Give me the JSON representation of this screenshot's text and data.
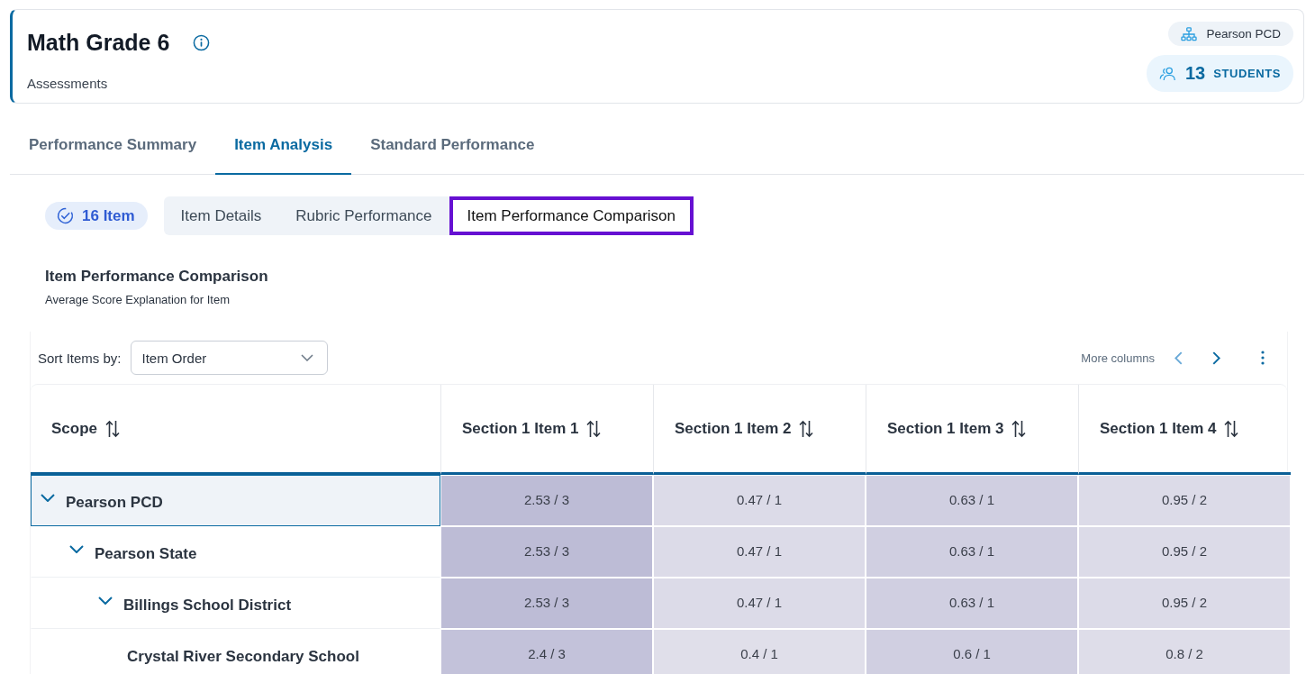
{
  "header": {
    "title": "Math Grade 6",
    "subtitle": "Assessments",
    "org": "Pearson PCD",
    "student_count": "13",
    "student_label": "STUDENTS"
  },
  "tabs": [
    {
      "label": "Performance Summary",
      "selected": false
    },
    {
      "label": "Item Analysis",
      "selected": true
    },
    {
      "label": "Standard Performance",
      "selected": false
    }
  ],
  "item_count": "16 Item",
  "subtabs": [
    {
      "label": "Item Details",
      "selected": false
    },
    {
      "label": "Rubric Performance",
      "selected": false
    },
    {
      "label": "Item Performance Comparison",
      "selected": true
    }
  ],
  "section": {
    "title": "Item Performance Comparison",
    "subtitle": "Average Score Explanation for Item"
  },
  "sort": {
    "label": "Sort Items by:",
    "value": "Item Order"
  },
  "pager": {
    "label": "More columns",
    "previous_disabled": true,
    "next_disabled": false
  },
  "table": {
    "scope_column": "Scope",
    "columns": [
      "Section 1 Item 1",
      "Section 1 Item 2",
      "Section 1 Item 3",
      "Section 1 Item 4"
    ],
    "rows": [
      {
        "scope": "Pearson PCD",
        "expanded": true,
        "selected": true,
        "cells": [
          {
            "text": "2.53 / 3",
            "color": "#bdbcd6"
          },
          {
            "text": "0.47 / 1",
            "color": "#dcdbe8"
          },
          {
            "text": "0.63 / 1",
            "color": "#d0cfe1"
          },
          {
            "text": "0.95 / 2",
            "color": "#dcdbe8"
          }
        ],
        "children": [
          {
            "scope": "Pearson State",
            "expanded": true,
            "selected": false,
            "cells": [
              {
                "text": "2.53 / 3",
                "color": "#bdbcd6"
              },
              {
                "text": "0.47 / 1",
                "color": "#dcdbe8"
              },
              {
                "text": "0.63 / 1",
                "color": "#d0cfe1"
              },
              {
                "text": "0.95 / 2",
                "color": "#dcdbe8"
              }
            ],
            "children": [
              {
                "scope": "Billings School District",
                "expanded": true,
                "selected": false,
                "cells": [
                  {
                    "text": "2.53 / 3",
                    "color": "#bdbcd6"
                  },
                  {
                    "text": "0.47 / 1",
                    "color": "#dcdbe8"
                  },
                  {
                    "text": "0.63 / 1",
                    "color": "#d0cfe1"
                  },
                  {
                    "text": "0.95 / 2",
                    "color": "#dcdbe8"
                  }
                ],
                "children": [
                  {
                    "scope": "Crystal River Secondary School",
                    "selected": false,
                    "cells": [
                      {
                        "text": "2.4 / 3",
                        "color": "#c3c2da"
                      },
                      {
                        "text": "0.4 / 1",
                        "color": "#e0dfea"
                      },
                      {
                        "text": "0.6 / 1",
                        "color": "#d0cfe1"
                      },
                      {
                        "text": "0.8 / 2",
                        "color": "#dedde9"
                      }
                    ]
                  }
                ]
              }
            ]
          }
        ]
      }
    ]
  }
}
